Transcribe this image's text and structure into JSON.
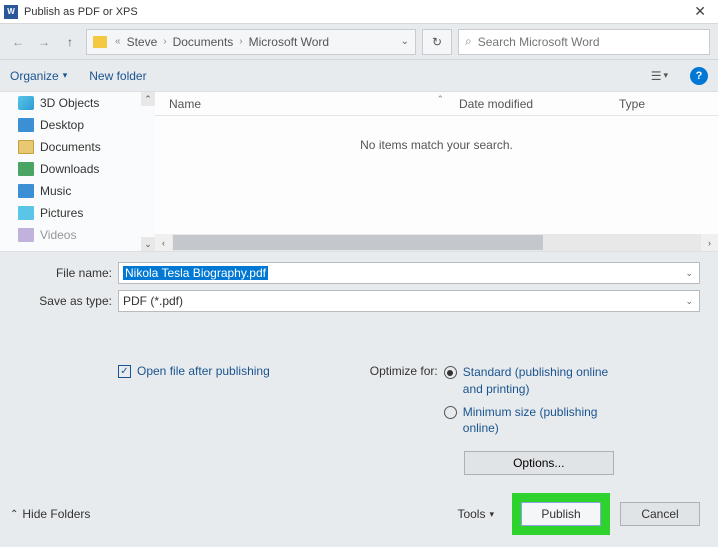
{
  "titlebar": {
    "app_letter": "W",
    "title": "Publish as PDF or XPS"
  },
  "nav": {
    "breadcrumb": [
      "Steve",
      "Documents",
      "Microsoft Word"
    ],
    "search_placeholder": "Search Microsoft Word"
  },
  "toolbar": {
    "organize": "Organize",
    "new_folder": "New folder"
  },
  "sidebar": {
    "items": [
      "3D Objects",
      "Desktop",
      "Documents",
      "Downloads",
      "Music",
      "Pictures",
      "Videos"
    ]
  },
  "filelist": {
    "col_name": "Name",
    "col_date": "Date modified",
    "col_type": "Type",
    "empty": "No items match your search."
  },
  "form": {
    "filename_label": "File name:",
    "filename_value": "Nikola Tesla Biography.pdf",
    "savetype_label": "Save as type:",
    "savetype_value": "PDF (*.pdf)"
  },
  "options": {
    "open_after": "Open file after publishing",
    "optimize_label": "Optimize for:",
    "radio_standard": "Standard (publishing online and printing)",
    "radio_minimum": "Minimum size (publishing online)",
    "options_btn": "Options..."
  },
  "footer": {
    "hide_folders": "Hide Folders",
    "tools": "Tools",
    "publish": "Publish",
    "cancel": "Cancel"
  }
}
